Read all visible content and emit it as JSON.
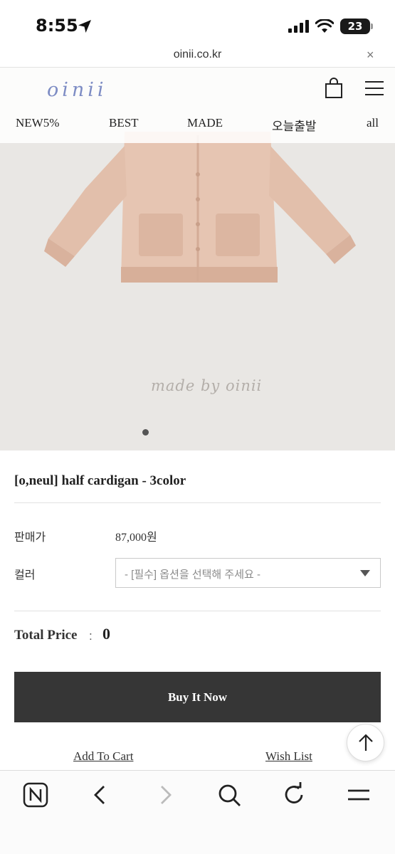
{
  "status_bar": {
    "time": "8:55",
    "battery": "23"
  },
  "browser": {
    "url": "oinii.co.kr",
    "close": "×"
  },
  "site": {
    "logo": "oinii",
    "nav": [
      "NEW5%",
      "BEST",
      "MADE",
      "오늘출발",
      "all"
    ]
  },
  "hero": {
    "watermark": "made by oinii"
  },
  "product": {
    "title": "[o,neul] half cardigan - 3color",
    "price_label": "판매가",
    "price": "87,000원",
    "color_label": "컬러",
    "color_placeholder": "- [필수] 옵션을 선택해 주세요 -",
    "total_label": "Total Price",
    "total_sep": ":",
    "total_value": "0"
  },
  "actions": {
    "buy": "Buy It Now",
    "add_to_cart": "Add To Cart",
    "wish_list": "Wish List"
  }
}
